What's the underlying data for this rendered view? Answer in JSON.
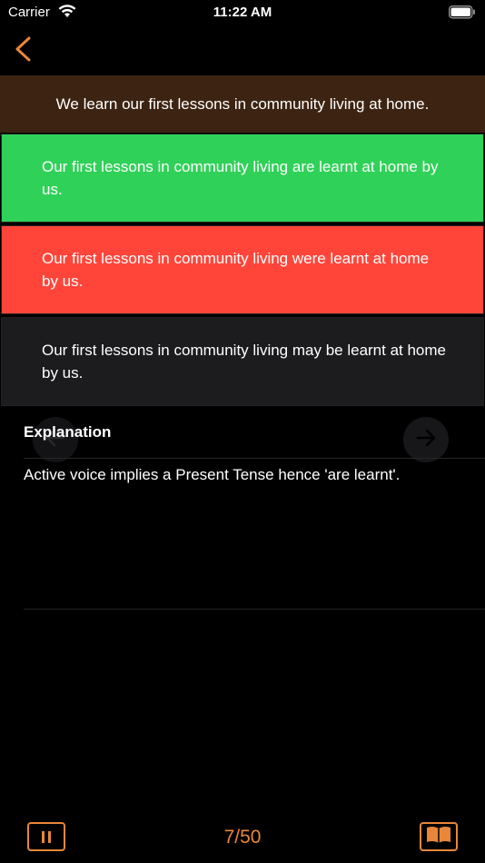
{
  "status": {
    "carrier": "Carrier",
    "time": "11:22 AM"
  },
  "colors": {
    "accent": "#e8873a",
    "question_bg": "#3d2412",
    "correct": "#30d158",
    "wrong": "#ff453a",
    "neutral": "#1c1c1e"
  },
  "question": "We learn our first lessons in community living at home.",
  "options": [
    {
      "text": "Our first lessons in community living are learnt at home by us.",
      "state": "correct"
    },
    {
      "text": "Our first lessons in community living were learnt at home by us.",
      "state": "wrong"
    },
    {
      "text": "Our first lessons in community living may be learnt at home by us.",
      "state": "neutral"
    }
  ],
  "explanation": {
    "title": "Explanation",
    "text": "Active voice implies a Present Tense hence 'are learnt'."
  },
  "footer": {
    "counter": "7/50"
  },
  "icons": {
    "back": "chevron-left-icon",
    "prev": "arrow-left-icon",
    "next": "arrow-right-icon",
    "pause": "pause-icon",
    "book": "book-icon"
  }
}
